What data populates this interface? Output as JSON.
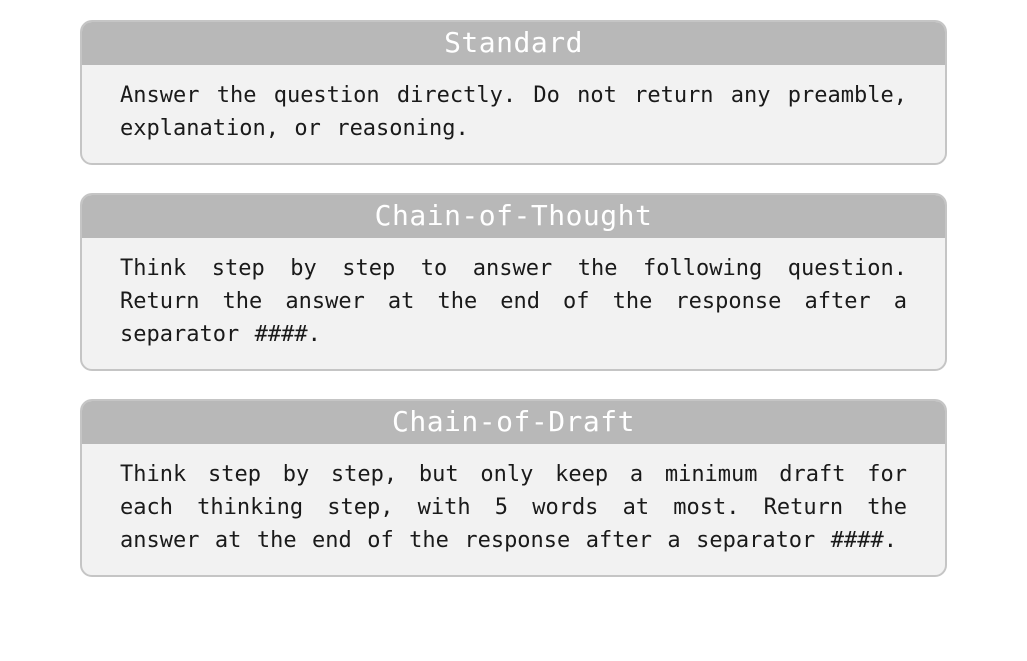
{
  "cards": [
    {
      "title": "Standard",
      "body": "Answer the question directly. Do not return any preamble, explanation, or reasoning."
    },
    {
      "title": "Chain-of-Thought",
      "body": "Think step by step to answer the following question. Return the answer at the end of the response after a separator ####."
    },
    {
      "title": "Chain-of-Draft",
      "body": "Think step by step, but only keep a minimum draft for each thinking step, with 5 words at most. Return the answer at the end of the response after a separator ####."
    }
  ]
}
